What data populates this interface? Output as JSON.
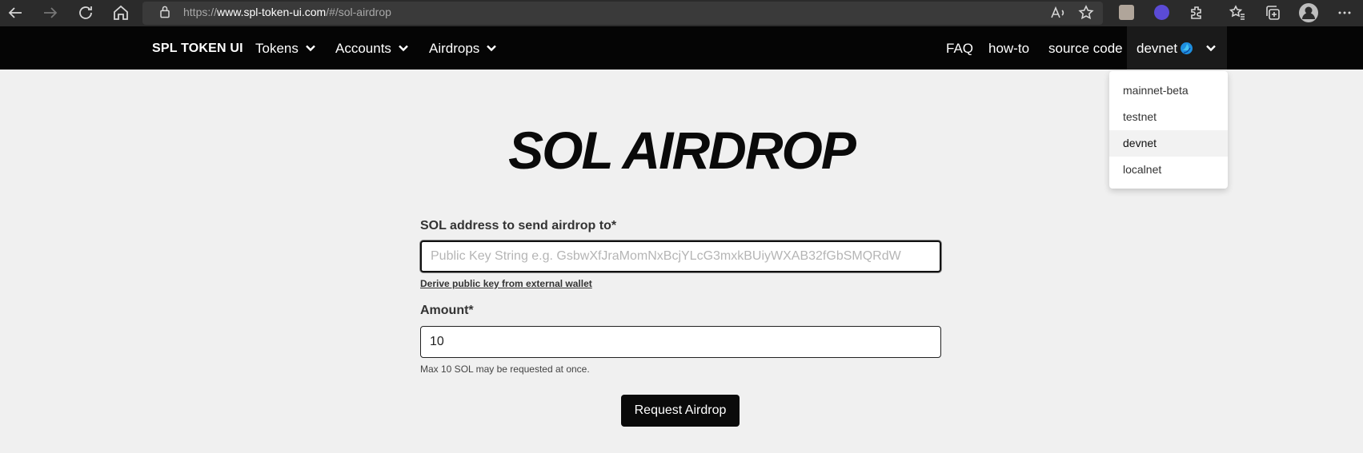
{
  "browser": {
    "url_prefix": "https://",
    "url_host": "www.spl-token-ui.com",
    "url_path": "/#/sol-airdrop"
  },
  "navbar": {
    "brand": "SPL TOKEN UI",
    "menus": [
      {
        "label": "Tokens"
      },
      {
        "label": "Accounts"
      },
      {
        "label": "Airdrops"
      }
    ],
    "links": [
      {
        "label": "FAQ"
      },
      {
        "label": "how-to"
      },
      {
        "label": "source code"
      }
    ],
    "network": "devnet"
  },
  "network_dropdown": {
    "options": [
      "mainnet-beta",
      "testnet",
      "devnet",
      "localnet"
    ],
    "selected": "devnet"
  },
  "main": {
    "title": "SOL AIRDROP",
    "address_label": "SOL address to send airdrop to*",
    "address_placeholder": "Public Key String e.g. GsbwXfJraMomNxBcjYLcG3mxkBUiyWXAB32fGbSMQRdW",
    "address_value": "",
    "derive_link": "Derive public key from external wallet",
    "amount_label": "Amount*",
    "amount_value": "10",
    "amount_help": "Max 10 SOL may be requested at once.",
    "submit_label": "Request Airdrop"
  },
  "colors": {
    "navbar_bg": "#050505",
    "page_bg": "#f0f0f0",
    "button_bg": "#0a0a0a",
    "browser_bar": "#2b2b2b"
  }
}
